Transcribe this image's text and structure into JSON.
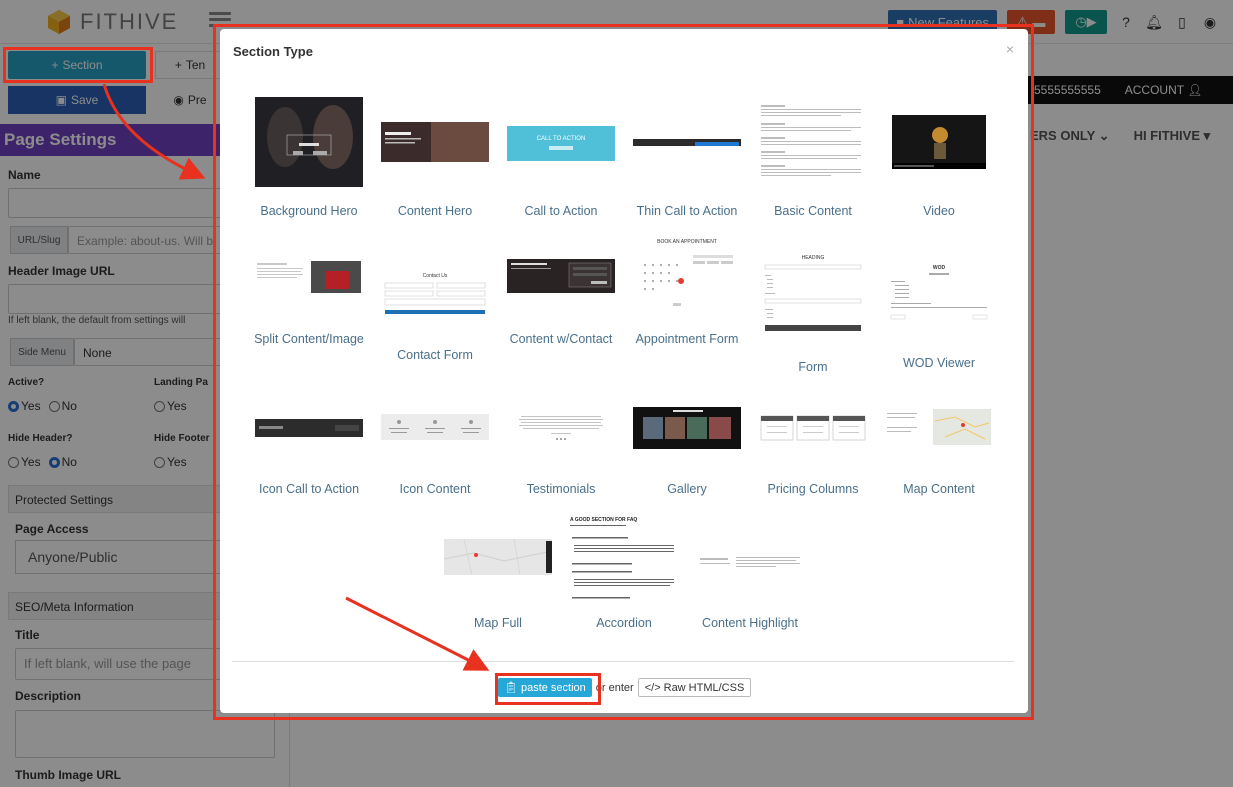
{
  "app": {
    "brand": "FITHIVE",
    "top_buttons": {
      "new_features": "New Features"
    },
    "left": {
      "section_button": "Section",
      "template_button": "Ten",
      "save_button": "Save",
      "preview_button": "Pre",
      "page_settings": "Page Settings",
      "name_label": "Name",
      "url_addon": "URL/Slug",
      "url_placeholder": "Example: about-us. Will b",
      "header_image_label": "Header Image URL",
      "header_help": "If left blank, the default from settings will",
      "side_menu_addon": "Side Menu",
      "side_menu_value": "None",
      "active_label": "Active?",
      "landing_label": "Landing Pa",
      "hide_header_label": "Hide Header?",
      "hide_footer_label": "Hide Footer",
      "yes": "Yes",
      "no": "No",
      "protected_settings": "Protected Settings",
      "page_access_label": "Page Access",
      "page_access_value": "Anyone/Public",
      "seo_header": "SEO/Meta Information",
      "title_label": "Title",
      "title_placeholder": "If left blank, will use the page",
      "description_label": "Description",
      "thumb_label": "Thumb Image URL"
    },
    "darkbar": {
      "phone": "5555555555",
      "account": "ACCOUNT"
    },
    "nav": {
      "members": "ERS ONLY",
      "hi": "HI FITHIVE"
    }
  },
  "modal": {
    "title": "Section Type",
    "close": "×",
    "sections": [
      {
        "label": "Background Hero"
      },
      {
        "label": "Content Hero"
      },
      {
        "label": "Call to Action",
        "thumb_text": "CALL TO ACTION"
      },
      {
        "label": "Thin Call to Action"
      },
      {
        "label": "Basic Content"
      },
      {
        "label": "Video"
      },
      {
        "label": "Split Content/Image"
      },
      {
        "label": "Contact Form",
        "thumb_text": "Contact Us"
      },
      {
        "label": "Content w/Contact"
      },
      {
        "label": "Appointment Form",
        "thumb_text": "BOOK AN APPOINTMENT"
      },
      {
        "label": "Form",
        "thumb_text": "HEADING"
      },
      {
        "label": "WOD Viewer",
        "thumb_text": "WOD"
      },
      {
        "label": "Icon Call to Action"
      },
      {
        "label": "Icon Content"
      },
      {
        "label": "Testimonials"
      },
      {
        "label": "Gallery"
      },
      {
        "label": "Pricing Columns"
      },
      {
        "label": "Map Content"
      },
      {
        "label": "Map Full"
      },
      {
        "label": "Accordion",
        "thumb_text": "A GOOD SECTION FOR FAQ"
      },
      {
        "label": "Content Highlight"
      }
    ],
    "footer": {
      "paste_button": "paste section",
      "or_enter": "or enter",
      "raw_button": "Raw HTML/CSS"
    }
  }
}
